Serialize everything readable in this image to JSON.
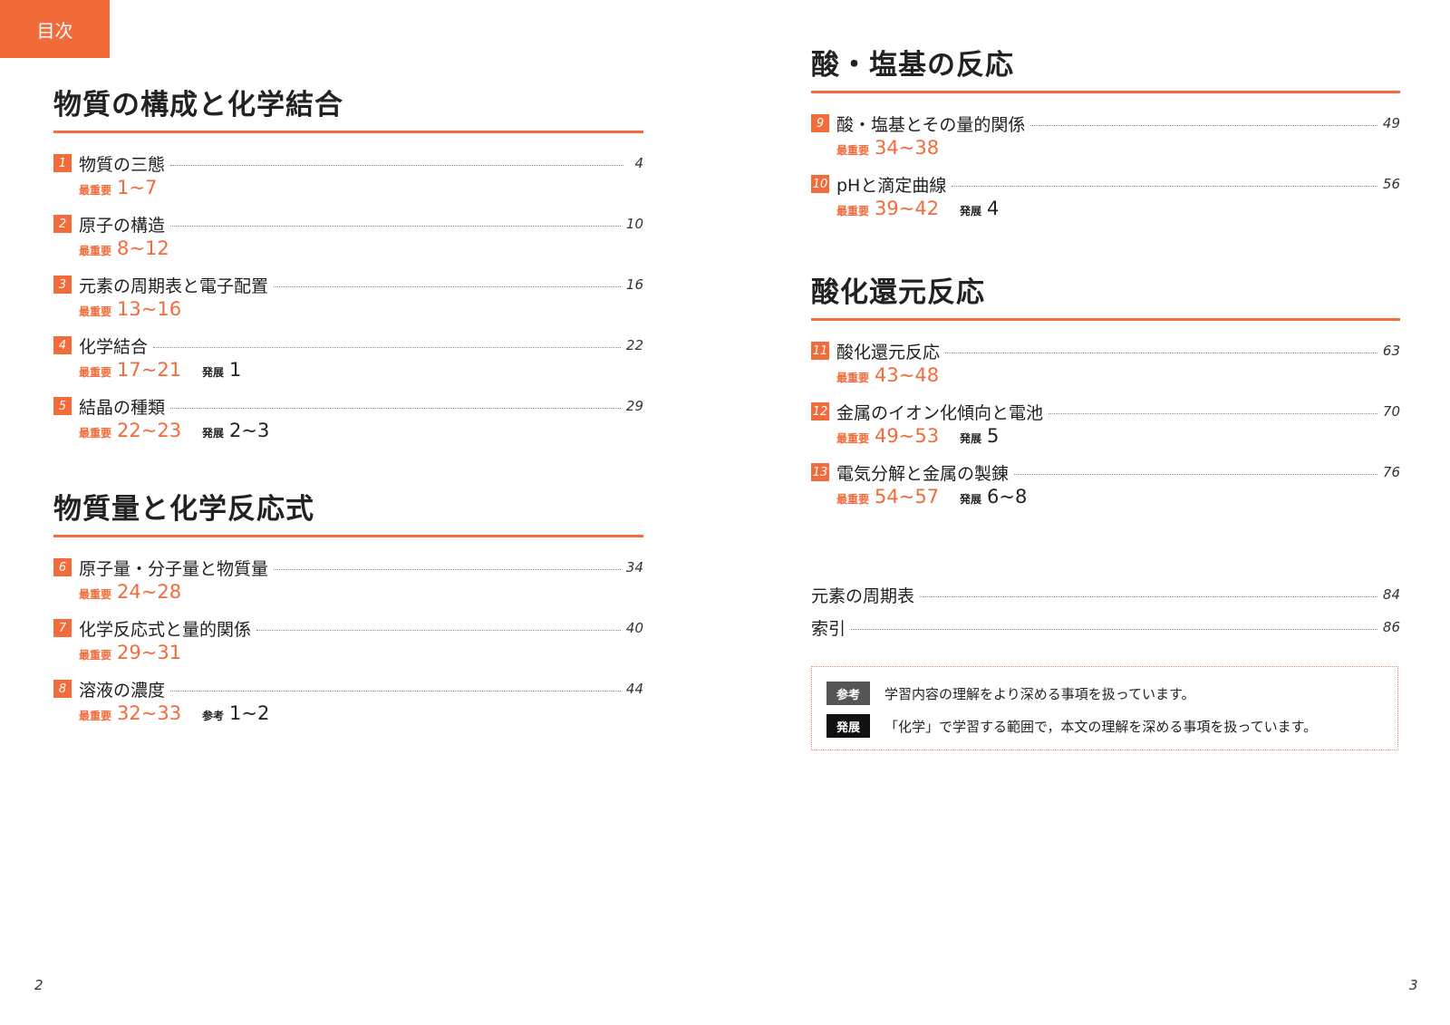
{
  "header_tab": "目次",
  "colors": {
    "accent": "#f26b3a",
    "sanko_badge": "#555555",
    "hatten_badge": "#111111"
  },
  "labels": {
    "important": "最重要",
    "advanced": "発展",
    "reference": "参考"
  },
  "left_sections": [
    {
      "title": "物質の構成と化学結合",
      "entries": [
        {
          "num": "1",
          "title": "物質の三態",
          "page": "4",
          "important": "1~7",
          "extra_tag": "",
          "extra_range": ""
        },
        {
          "num": "2",
          "title": "原子の構造",
          "page": "10",
          "important": "8~12",
          "extra_tag": "",
          "extra_range": ""
        },
        {
          "num": "3",
          "title": "元素の周期表と電子配置",
          "page": "16",
          "important": "13~16",
          "extra_tag": "",
          "extra_range": ""
        },
        {
          "num": "4",
          "title": "化学結合",
          "page": "22",
          "important": "17~21",
          "extra_tag": "発展",
          "extra_range": "1"
        },
        {
          "num": "5",
          "title": "結晶の種類",
          "page": "29",
          "important": "22~23",
          "extra_tag": "発展",
          "extra_range": "2~3"
        }
      ]
    },
    {
      "title": "物質量と化学反応式",
      "entries": [
        {
          "num": "6",
          "title": "原子量・分子量と物質量",
          "page": "34",
          "important": "24~28",
          "extra_tag": "",
          "extra_range": ""
        },
        {
          "num": "7",
          "title": "化学反応式と量的関係",
          "page": "40",
          "important": "29~31",
          "extra_tag": "",
          "extra_range": ""
        },
        {
          "num": "8",
          "title": "溶液の濃度",
          "page": "44",
          "important": "32~33",
          "extra_tag": "参考",
          "extra_range": "1~2"
        }
      ]
    }
  ],
  "right_sections": [
    {
      "title": "酸・塩基の反応",
      "entries": [
        {
          "num": "9",
          "title": "酸・塩基とその量的関係",
          "page": "49",
          "important": "34~38",
          "extra_tag": "",
          "extra_range": ""
        },
        {
          "num": "10",
          "title": "pHと滴定曲線",
          "page": "56",
          "important": "39~42",
          "extra_tag": "発展",
          "extra_range": "4"
        }
      ]
    },
    {
      "title": "酸化還元反応",
      "entries": [
        {
          "num": "11",
          "title": "酸化還元反応",
          "page": "63",
          "important": "43~48",
          "extra_tag": "",
          "extra_range": ""
        },
        {
          "num": "12",
          "title": "金属のイオン化傾向と電池",
          "page": "70",
          "important": "49~53",
          "extra_tag": "発展",
          "extra_range": "5"
        },
        {
          "num": "13",
          "title": "電気分解と金属の製錬",
          "page": "76",
          "important": "54~57",
          "extra_tag": "発展",
          "extra_range": "6~8"
        }
      ]
    }
  ],
  "appendix": [
    {
      "title": "元素の周期表",
      "page": "84"
    },
    {
      "title": "索引",
      "page": "86"
    }
  ],
  "legend": [
    {
      "badge": "参考",
      "text": "学習内容の理解をより深める事項を扱っています。"
    },
    {
      "badge": "発展",
      "text": "「化学」で学習する範囲で，本文の理解を深める事項を扱っています。"
    }
  ],
  "page_numbers": {
    "left": "2",
    "right": "3"
  }
}
